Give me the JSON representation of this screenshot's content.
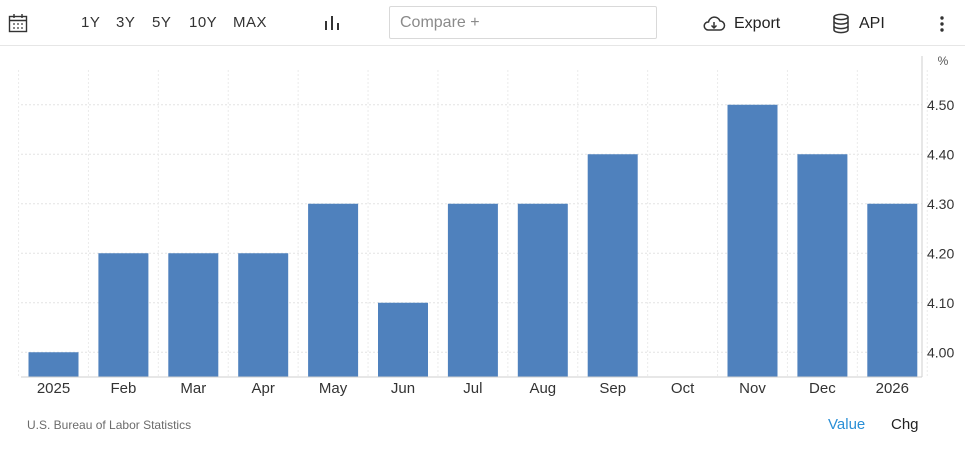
{
  "toolbar": {
    "calendar_icon": "calendar-icon",
    "ranges": [
      "1Y",
      "3Y",
      "5Y",
      "10Y",
      "MAX"
    ],
    "chart_type_icon": "bar-chart-icon",
    "compare_placeholder": "Compare +",
    "export_label": "Export",
    "export_icon": "cloud-download-icon",
    "api_label": "API",
    "api_icon": "database-icon",
    "more_icon": "vertical-dots-icon"
  },
  "chart_data": {
    "type": "bar",
    "unit": "%",
    "categories": [
      "2025",
      "Feb",
      "Mar",
      "Apr",
      "May",
      "Jun",
      "Jul",
      "Aug",
      "Sep",
      "Oct",
      "Nov",
      "Dec",
      "2026"
    ],
    "values": [
      4.0,
      4.2,
      4.2,
      4.2,
      4.3,
      4.1,
      4.3,
      4.3,
      4.4,
      null,
      4.5,
      4.4,
      4.3
    ],
    "yticks": [
      "4.00",
      "4.10",
      "4.20",
      "4.30",
      "4.40",
      "4.50"
    ],
    "ylim": [
      3.95,
      4.55
    ],
    "y_axis_side": "right",
    "grid": true,
    "bar_color": "#4f81bd"
  },
  "footer": {
    "source": "U.S. Bureau of Labor Statistics",
    "value_label": "Value",
    "chg_label": "Chg",
    "active_color": "#2a8fd6"
  }
}
